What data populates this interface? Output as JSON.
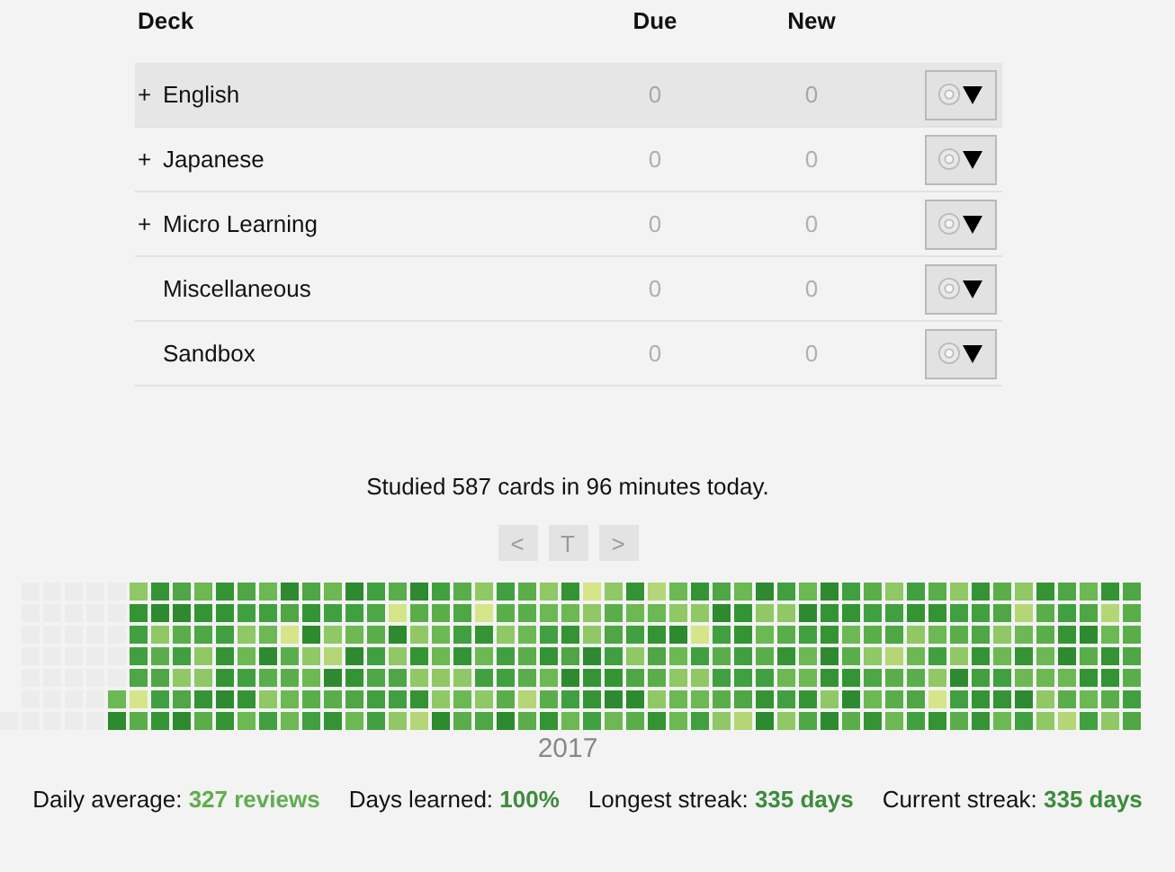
{
  "deck_table": {
    "columns": [
      "Deck",
      "Due",
      "New"
    ],
    "rows": [
      {
        "expander": "+",
        "name": "English",
        "due": "0",
        "new": "0",
        "selected": true
      },
      {
        "expander": "+",
        "name": "Japanese",
        "due": "0",
        "new": "0",
        "selected": false
      },
      {
        "expander": "+",
        "name": "Micro Learning",
        "due": "0",
        "new": "0",
        "selected": false
      },
      {
        "name": "Miscellaneous",
        "due": "0",
        "new": "0",
        "selected": false
      },
      {
        "name": "Sandbox",
        "due": "0",
        "new": "0",
        "selected": false
      }
    ]
  },
  "studied_summary": "Studied 587 cards in 96 minutes today.",
  "heatmap_nav": [
    "<",
    "T",
    ">"
  ],
  "heatmap_year": "2017",
  "stats": [
    {
      "label": "Daily average:",
      "value": "327 reviews",
      "color": "#62ad4f"
    },
    {
      "label": "Days learned:",
      "value": "100%",
      "color": "#3c8c3c"
    },
    {
      "label": "Longest streak:",
      "value": "335 days",
      "color": "#3c8c3c"
    },
    {
      "label": "Current streak:",
      "value": "335 days",
      "color": "#3c8c3c"
    }
  ]
}
